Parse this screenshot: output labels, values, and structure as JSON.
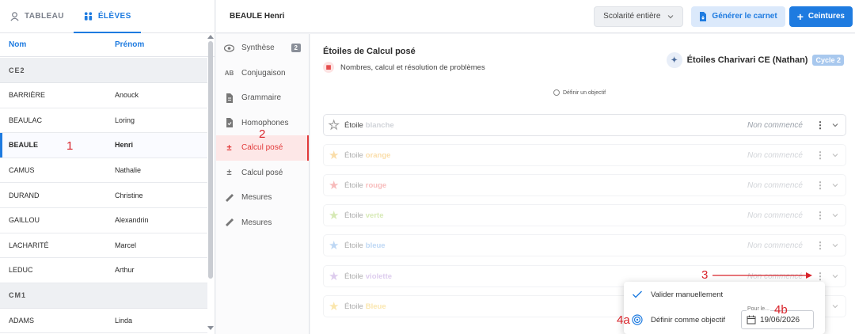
{
  "left_panel": {
    "tabs": [
      {
        "label": "TABLEAU",
        "active": false
      },
      {
        "label": "ÉLÈVES",
        "active": true
      }
    ],
    "columns": {
      "last_name": "Nom",
      "first_name": "Prénom"
    },
    "groups": [
      {
        "name": "CE2",
        "students": [
          {
            "last": "BARRIÈRE",
            "first": "Anouck"
          },
          {
            "last": "BEAULAC",
            "first": "Loring"
          },
          {
            "last": "BEAULE",
            "first": "Henri",
            "selected": true
          },
          {
            "last": "CAMUS",
            "first": "Nathalie"
          },
          {
            "last": "DURAND",
            "first": "Christine"
          },
          {
            "last": "GAILLOU",
            "first": "Alexandrin"
          },
          {
            "last": "LACHARITÉ",
            "first": "Marcel"
          },
          {
            "last": "LEDUC",
            "first": "Arthur"
          }
        ]
      },
      {
        "name": "CM1",
        "students": [
          {
            "last": "ADAMS",
            "first": "Linda"
          }
        ]
      }
    ]
  },
  "header": {
    "student_name": "BEAULE Henri",
    "period_select": "Scolarité entière",
    "generate_button": "Générer le carnet",
    "belts_button": "Ceintures"
  },
  "nav": {
    "items": [
      {
        "label": "Synthèse",
        "icon": "eye-icon",
        "badge": "2"
      },
      {
        "label": "Conjugaison",
        "icon": "ab-icon"
      },
      {
        "label": "Grammaire",
        "icon": "document-icon"
      },
      {
        "label": "Homophones",
        "icon": "document-check-icon"
      },
      {
        "label": "Calcul posé",
        "icon": "plus-minus-icon",
        "active": true
      },
      {
        "label": "Calcul posé",
        "icon": "plus-minus-icon"
      },
      {
        "label": "Mesures",
        "icon": "ruler-icon"
      },
      {
        "label": "Mesures",
        "icon": "ruler-icon"
      }
    ]
  },
  "main": {
    "title": "Étoiles de Calcul posé",
    "domain": "Nombres, calcul et résolution de problèmes",
    "progression": "Étoiles Charivari CE (Nathan)",
    "cycle": "Cycle 2",
    "objective_link": "Définir un objectif",
    "stars": [
      {
        "prefix": "Étoile",
        "color_name": "blanche",
        "color": "#d0d3d8",
        "state": "Non commencé"
      },
      {
        "prefix": "Étoile",
        "color_name": "orange",
        "color": "#f5b642",
        "state": "Non commencé"
      },
      {
        "prefix": "Étoile",
        "color_name": "rouge",
        "color": "#ef6b6b",
        "state": "Non commencé"
      },
      {
        "prefix": "Étoile",
        "color_name": "verte",
        "color": "#a6cf5c",
        "state": "Non commencé"
      },
      {
        "prefix": "Étoile",
        "color_name": "bleue",
        "color": "#6fa8e8",
        "state": "Non commencé"
      },
      {
        "prefix": "Étoile",
        "color_name": "violette",
        "color": "#b48fd9",
        "state": "Non commencé"
      },
      {
        "prefix": "Étoile",
        "color_name": "Bleue",
        "color": "#f5c84c",
        "state": "Non commencé"
      }
    ]
  },
  "popup": {
    "validate": "Valider manuellement",
    "set_objective": "Définir comme objectif",
    "date_label": "Pour le...",
    "date_value": "19/06/2026"
  },
  "annotations": {
    "n1": "1",
    "n2": "2",
    "n3": "3",
    "n4a": "4a",
    "n4b": "4b"
  }
}
